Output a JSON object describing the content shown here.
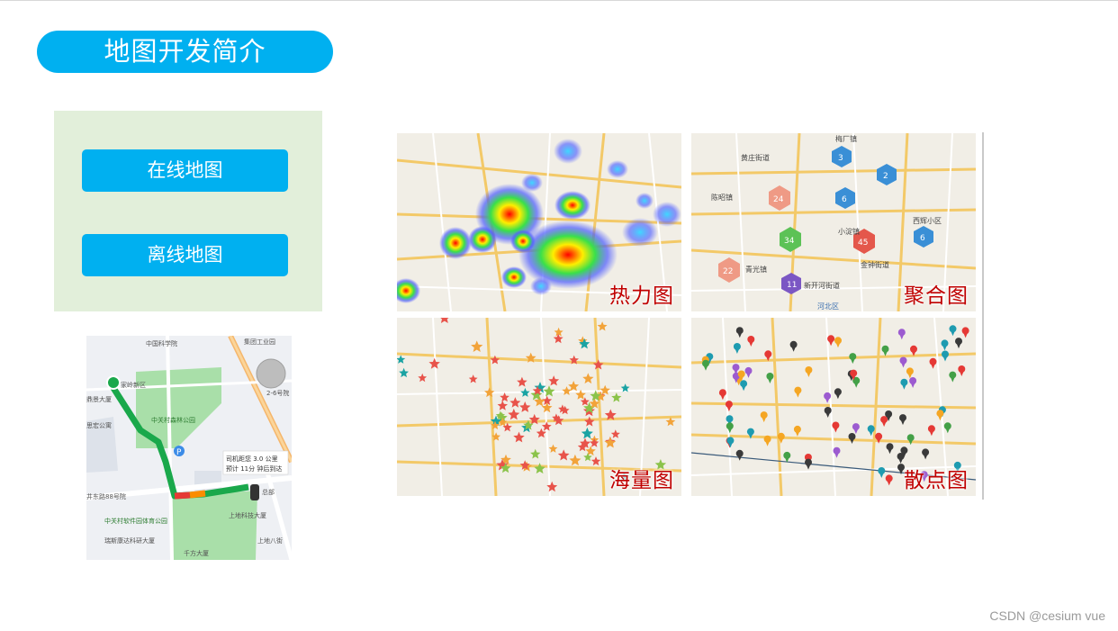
{
  "page": {
    "title": "地图开发简介",
    "watermark": "CSDN @cesium vue"
  },
  "menu": {
    "online_label": "在线地图",
    "offline_label": "离线地图"
  },
  "colors": {
    "accent": "#00b0f0",
    "panel_bg": "#e2efda",
    "label_red": "#c00000"
  },
  "phone_map": {
    "place_labels": [
      "中国科学院",
      "集团工业园",
      "家岭新区",
      "鼎景大厦",
      "中关村森林公园",
      "思宏公寓",
      "井东路88号院",
      "中关村软件园体育公园",
      "瑞斯康达科研大厦",
      "千方大厦",
      "上地科技大厦",
      "总部",
      "上地八街",
      "2-6号院"
    ],
    "info_line1": "司机距您 3.0 公里",
    "info_line2": "预计 11分 钟后到达",
    "info_distance": "3.0",
    "info_minutes": "11"
  },
  "maps": [
    {
      "label": "热力图",
      "kind": "heatmap"
    },
    {
      "label": "聚合图",
      "kind": "cluster",
      "cluster_counts": [
        "3",
        "2",
        "24",
        "6",
        "6",
        "34",
        "45",
        "22",
        "11"
      ],
      "place_labels": [
        "梅厂镇",
        "黄庄街道",
        "陈昭镇",
        "小淀镇",
        "西辉小区",
        "青光镇",
        "金钟街道",
        "新开河街道",
        "河北区"
      ]
    },
    {
      "label": "海量图",
      "kind": "massive"
    },
    {
      "label": "散点图",
      "kind": "scatter"
    }
  ]
}
